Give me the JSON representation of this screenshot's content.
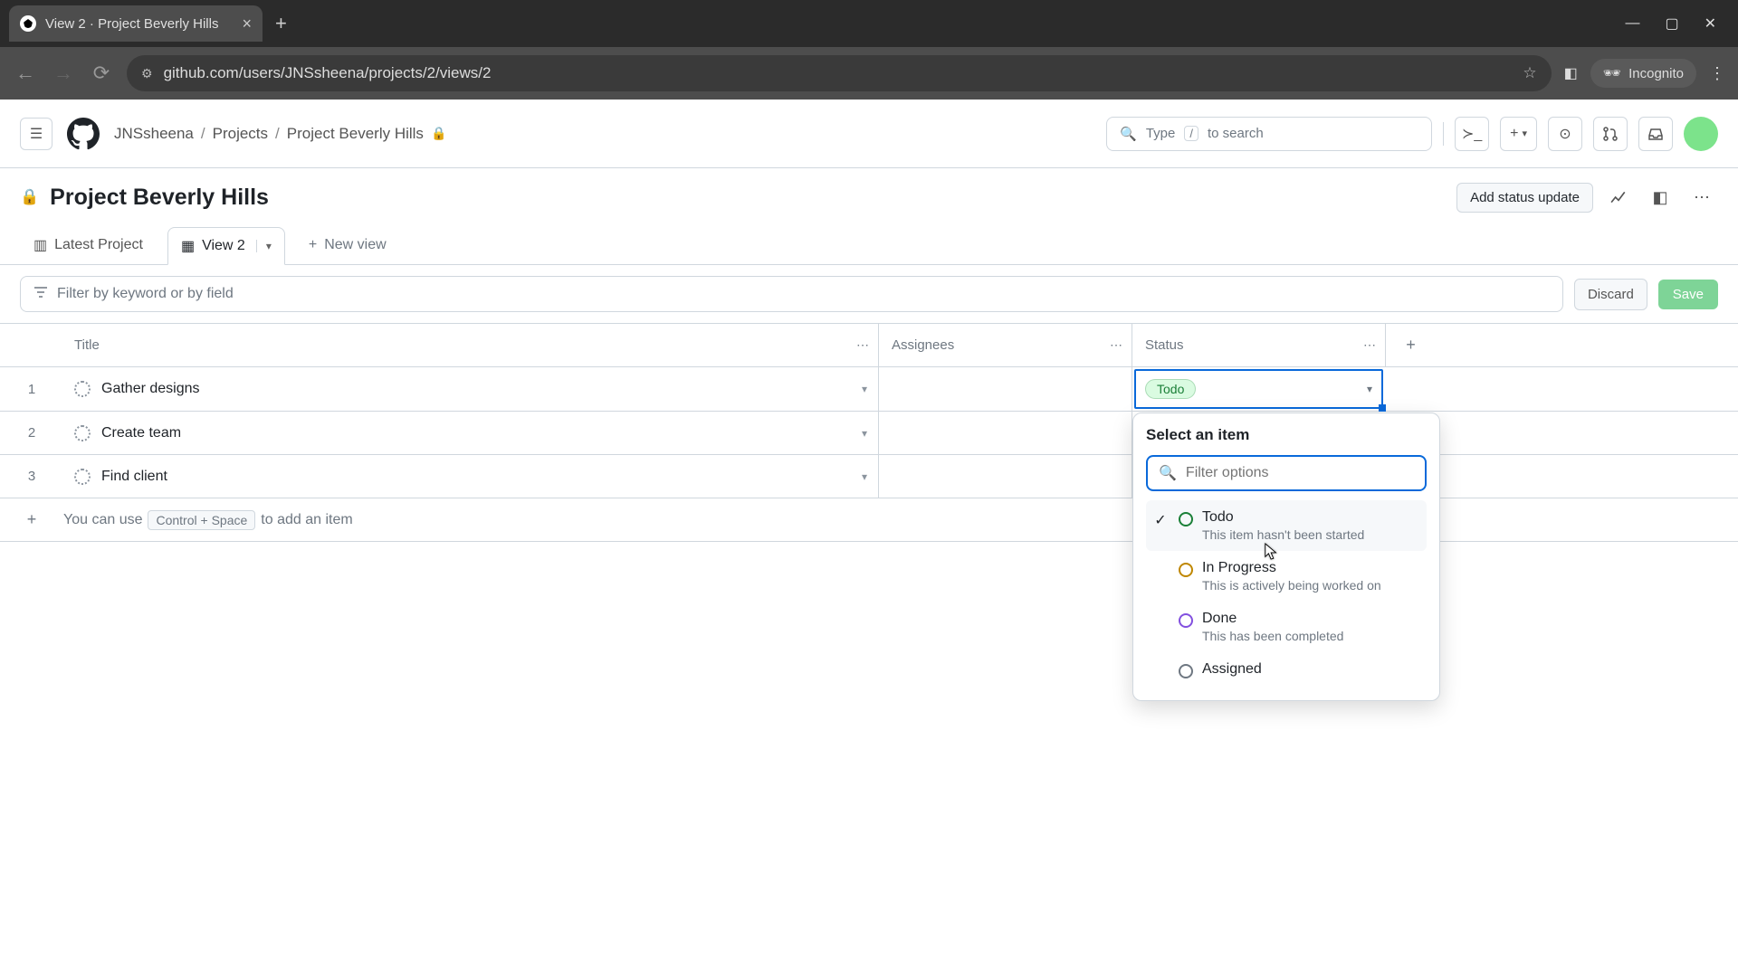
{
  "browser": {
    "tab_title": "View 2 · Project Beverly Hills",
    "url": "github.com/users/JNSsheena/projects/2/views/2",
    "incognito_label": "Incognito"
  },
  "github_header": {
    "breadcrumb": [
      "JNSsheena",
      "Projects",
      "Project Beverly Hills"
    ],
    "search_placeholder": "Type",
    "search_hint": "to search",
    "search_key": "/"
  },
  "project": {
    "title": "Project Beverly Hills",
    "add_status_label": "Add status update"
  },
  "views": {
    "tab1": "Latest Project",
    "tab2": "View 2",
    "new_view": "New view"
  },
  "filter": {
    "placeholder": "Filter by keyword or by field",
    "discard": "Discard",
    "save": "Save"
  },
  "columns": {
    "title": "Title",
    "assignees": "Assignees",
    "status": "Status"
  },
  "rows": [
    {
      "num": "1",
      "title": "Gather designs",
      "status": "Todo"
    },
    {
      "num": "2",
      "title": "Create team"
    },
    {
      "num": "3",
      "title": "Find client"
    }
  ],
  "add_item": {
    "prefix": "You can use",
    "key": "Control + Space",
    "suffix": "to add an item"
  },
  "popover": {
    "title": "Select an item",
    "search_placeholder": "Filter options",
    "options": [
      {
        "label": "Todo",
        "desc": "This item hasn't been started",
        "selected": true,
        "color": "green"
      },
      {
        "label": "In Progress",
        "desc": "This is actively being worked on",
        "color": "yellow"
      },
      {
        "label": "Done",
        "desc": "This has been completed",
        "color": "purple"
      },
      {
        "label": "Assigned",
        "desc": "",
        "color": "gray"
      }
    ]
  }
}
